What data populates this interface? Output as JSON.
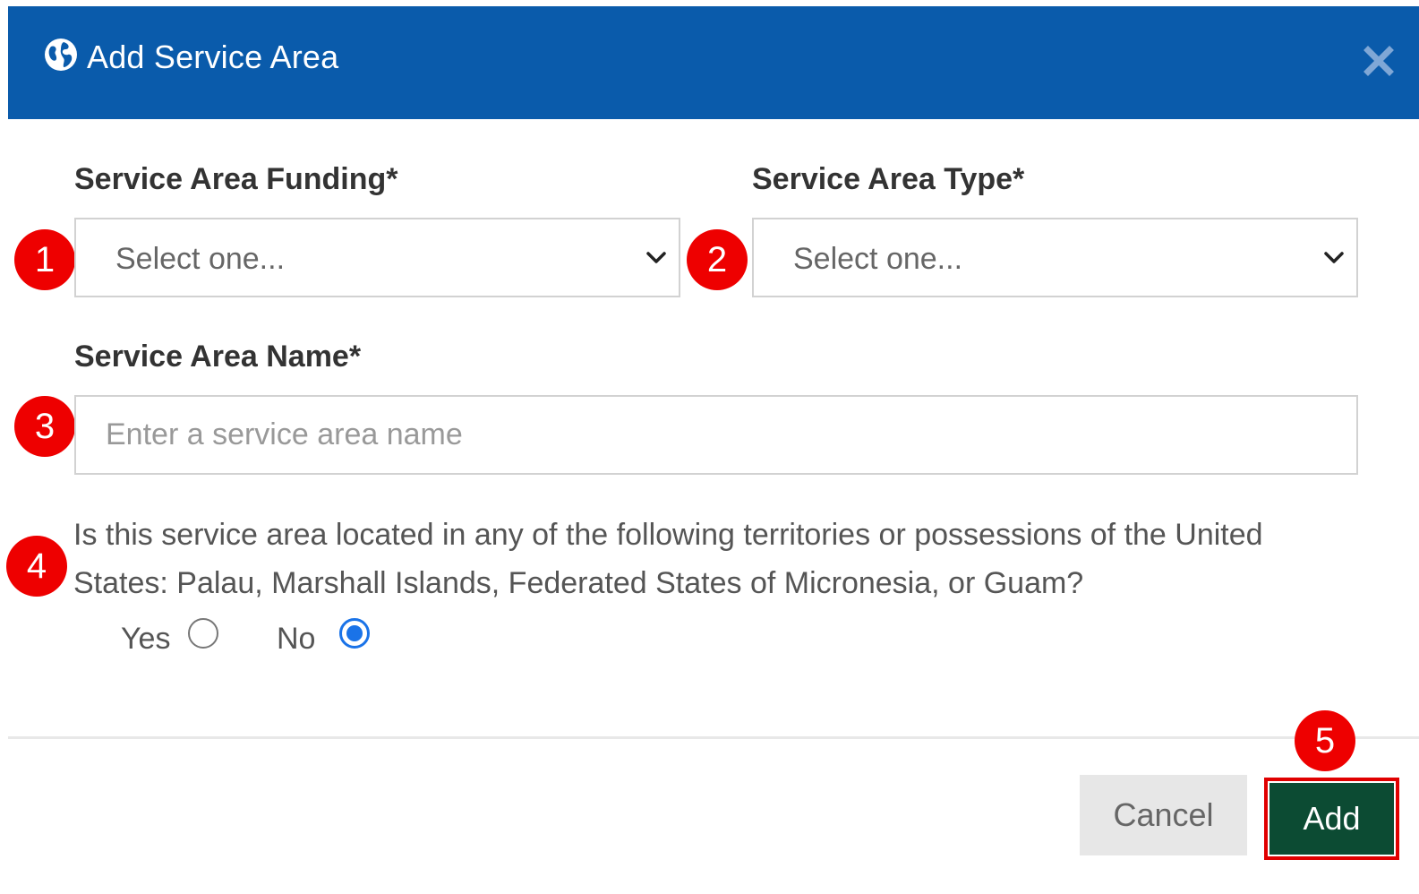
{
  "dialog": {
    "title": "Add Service Area",
    "header_color": "#0a5bab"
  },
  "form": {
    "funding": {
      "label": "Service Area Funding*",
      "selected": "Select one..."
    },
    "type": {
      "label": "Service Area Type*",
      "selected": "Select one..."
    },
    "name": {
      "label": "Service Area Name*",
      "placeholder": "Enter a service area name",
      "value": ""
    },
    "territory_question": {
      "text": "Is this service area located in any of the following territories or possessions of the United States: Palau, Marshall Islands, Federated States of Micronesia, or Guam?",
      "options": [
        {
          "label": "Yes",
          "checked": false
        },
        {
          "label": "No",
          "checked": true
        }
      ]
    }
  },
  "markers": [
    "1",
    "2",
    "3",
    "4",
    "5"
  ],
  "footer": {
    "cancel_label": "Cancel",
    "add_label": "Add",
    "add_color": "#0c4b33"
  },
  "icons": {
    "title_icon": "globe-icon",
    "close_icon": "close-icon",
    "dropdown_icon": "chevron-down-icon"
  }
}
